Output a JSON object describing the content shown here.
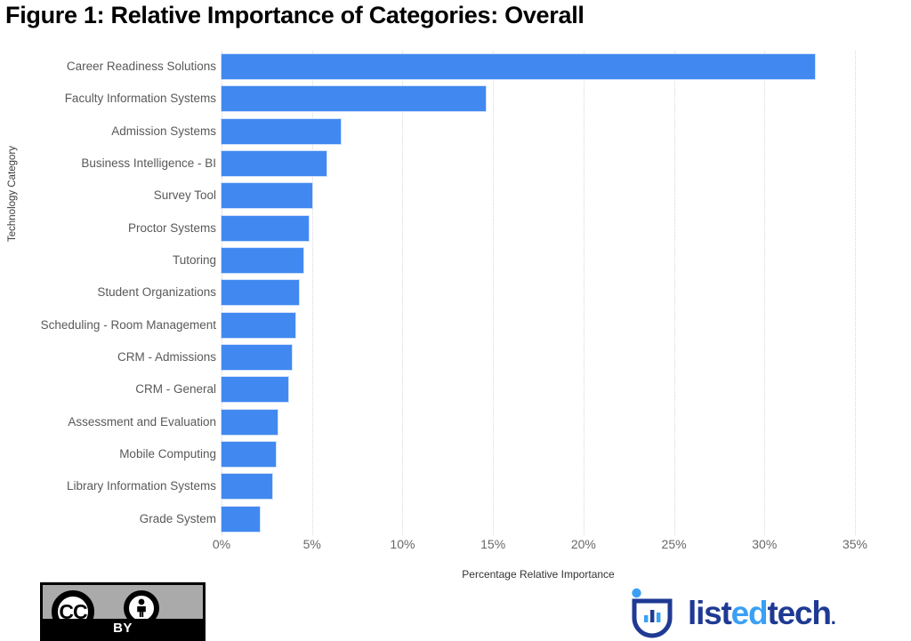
{
  "chart_data": {
    "type": "bar",
    "orientation": "horizontal",
    "title": "Figure 1: Relative Importance of Categories: Overall",
    "xlabel": "Percentage Relative Importance",
    "ylabel": "Technology Category",
    "xlim": [
      0,
      35
    ],
    "grid": "vertical-dotted",
    "legend": "none",
    "bar_color": "#4189f0",
    "xtick_labels": [
      "0%",
      "5%",
      "10%",
      "15%",
      "20%",
      "25%",
      "30%",
      "35%"
    ],
    "xtick_values": [
      0,
      5,
      10,
      15,
      20,
      25,
      30,
      35
    ],
    "categories": [
      "Career Readiness Solutions",
      "Faculty Information Systems",
      "Admission Systems",
      "Business Intelligence - BI",
      "Survey Tool",
      "Proctor Systems",
      "Tutoring",
      "Student Organizations",
      "Scheduling - Room Management",
      "CRM - Admissions",
      "CRM - General",
      "Assessment and Evaluation",
      "Mobile Computing",
      "Library Information Systems",
      "Grade System"
    ],
    "values": [
      32.8,
      14.6,
      6.6,
      5.8,
      5.0,
      4.8,
      4.5,
      4.3,
      4.1,
      3.9,
      3.7,
      3.1,
      3.0,
      2.8,
      2.1
    ]
  },
  "license_badge": {
    "name": "creative-commons-by",
    "cc_text": "CC",
    "by_text": "BY"
  },
  "brand": {
    "name": "listedtech",
    "part1": "list",
    "part2": "ed",
    "part3": "tech",
    "dot": ".",
    "color_dark": "#1f3a93",
    "color_light": "#3aa0f5"
  }
}
